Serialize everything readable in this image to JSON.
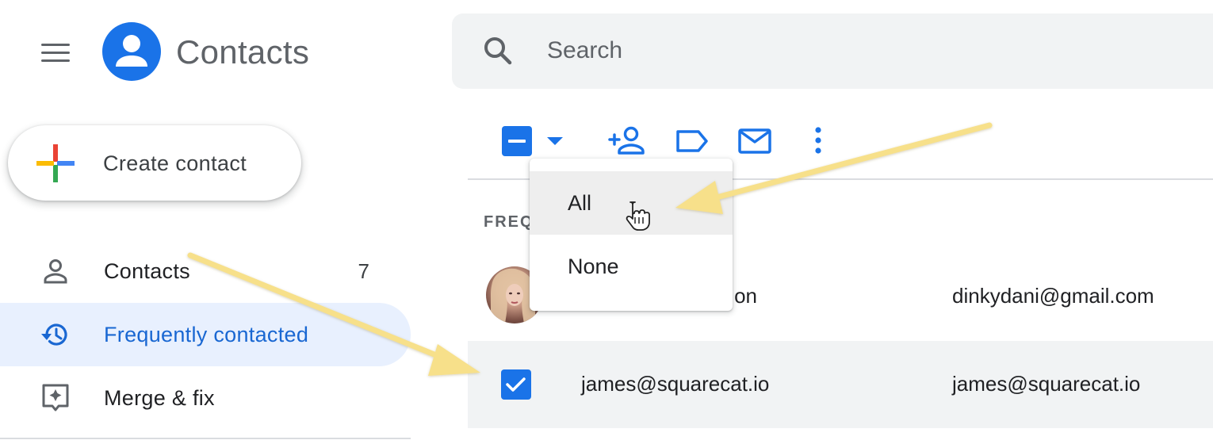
{
  "app": {
    "title": "Contacts"
  },
  "search": {
    "placeholder": "Search",
    "value": ""
  },
  "create_button": {
    "label": "Create contact"
  },
  "sidebar": {
    "items": [
      {
        "label": "Contacts",
        "count": "7",
        "icon": "person-icon"
      },
      {
        "label": "Frequently contacted",
        "icon": "history-icon",
        "selected": true
      },
      {
        "label": "Merge & fix",
        "icon": "merge-fix-icon"
      }
    ]
  },
  "toolbar": {
    "icons": [
      "select-checkbox",
      "select-dropdown-icon",
      "add-contact-icon",
      "label-icon",
      "email-icon",
      "more-vert-icon"
    ]
  },
  "select_menu": {
    "items": [
      "All",
      "None"
    ],
    "hovered": "All"
  },
  "list": {
    "section_header": "FREQ",
    "rows": [
      {
        "name": "on",
        "email": "dinkydani@gmail.com",
        "avatar": "photo",
        "checked": false
      },
      {
        "name": "james@squarecat.io",
        "email": "james@squarecat.io",
        "checked": true
      }
    ]
  },
  "colors": {
    "accent": "#1a73e8",
    "selected_nav_bg": "#e8f0fe",
    "selected_nav_text": "#1967d2",
    "annotation_arrow": "#f7e08a"
  }
}
